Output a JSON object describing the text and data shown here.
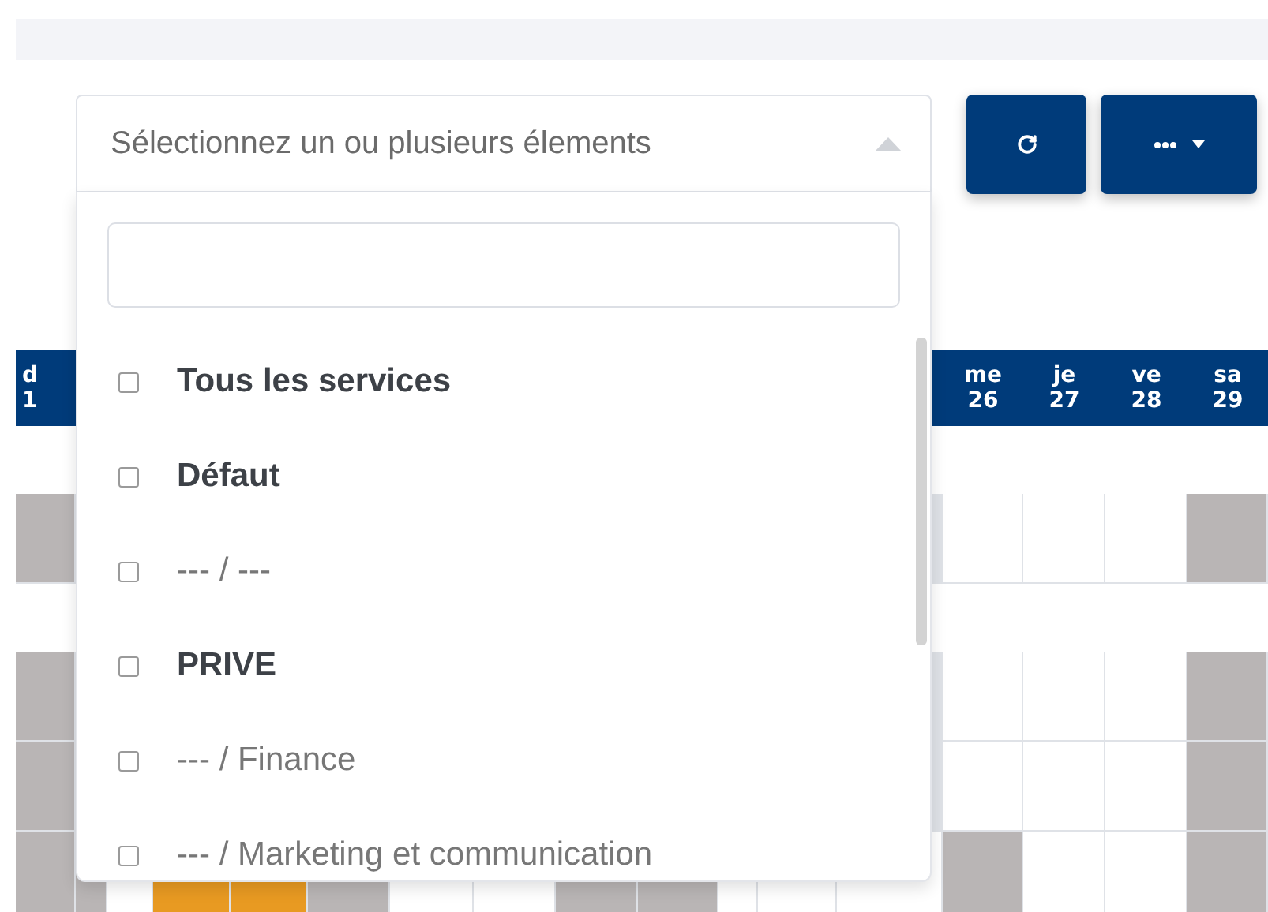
{
  "select": {
    "placeholder": "Sélectionnez un ou plusieurs élements",
    "expanded": true,
    "options": [
      {
        "label": "Tous les services",
        "kind": "group",
        "checked": false
      },
      {
        "label": "Défaut",
        "kind": "group",
        "checked": false
      },
      {
        "label": "--- / ---",
        "kind": "option",
        "checked": false
      },
      {
        "label": "PRIVE",
        "kind": "group",
        "checked": false
      },
      {
        "label": "--- / Finance",
        "kind": "option",
        "checked": false
      },
      {
        "label": "--- / Marketing et communication",
        "kind": "option",
        "checked": false
      }
    ]
  },
  "calendar": {
    "partial_day": {
      "day": "d",
      "date": "1"
    },
    "days": [
      {
        "day": "me",
        "date": "26"
      },
      {
        "day": "je",
        "date": "27"
      },
      {
        "day": "ve",
        "date": "28"
      },
      {
        "day": "sa",
        "date": "29"
      }
    ],
    "rows": [
      {
        "left": {
          "color": "#b9b5b5"
        },
        "right": [
          {
            "color": "#ffffff"
          },
          {
            "color": "#ffffff"
          },
          {
            "color": "#ffffff"
          },
          {
            "color": "#b9b5b5"
          }
        ]
      },
      {
        "left": {
          "color": "#b9b5b5"
        },
        "right": [
          {
            "color": "#ffffff"
          },
          {
            "color": "#ffffff"
          },
          {
            "color": "#ffffff"
          },
          {
            "color": "#b9b5b5"
          }
        ]
      },
      {
        "left": {
          "color": "#b9b5b5"
        },
        "right": [
          {
            "color": "#ffffff"
          },
          {
            "color": "#ffffff"
          },
          {
            "color": "#ffffff"
          },
          {
            "color": "#b9b5b5"
          }
        ]
      },
      {
        "left": {
          "color": "#b9b5b5"
        },
        "middle": [
          {
            "color": "#b9b5b5"
          },
          {
            "color": "#ffffff"
          },
          {
            "color": "#e89a22"
          },
          {
            "color": "#e89a22"
          },
          {
            "color": "#b9b5b5"
          },
          {
            "color": "#ffffff"
          },
          {
            "color": "#ffffff"
          },
          {
            "color": "#b9b5b5"
          },
          {
            "color": "#b9b5b5"
          },
          {
            "color": "#ffffff"
          },
          {
            "color": "#ffffff"
          },
          {
            "color": "#ffffff"
          }
        ],
        "right": [
          {
            "color": "#b9b5b5"
          },
          {
            "color": "#ffffff"
          },
          {
            "color": "#ffffff"
          },
          {
            "color": "#b9b5b5"
          }
        ]
      }
    ]
  }
}
